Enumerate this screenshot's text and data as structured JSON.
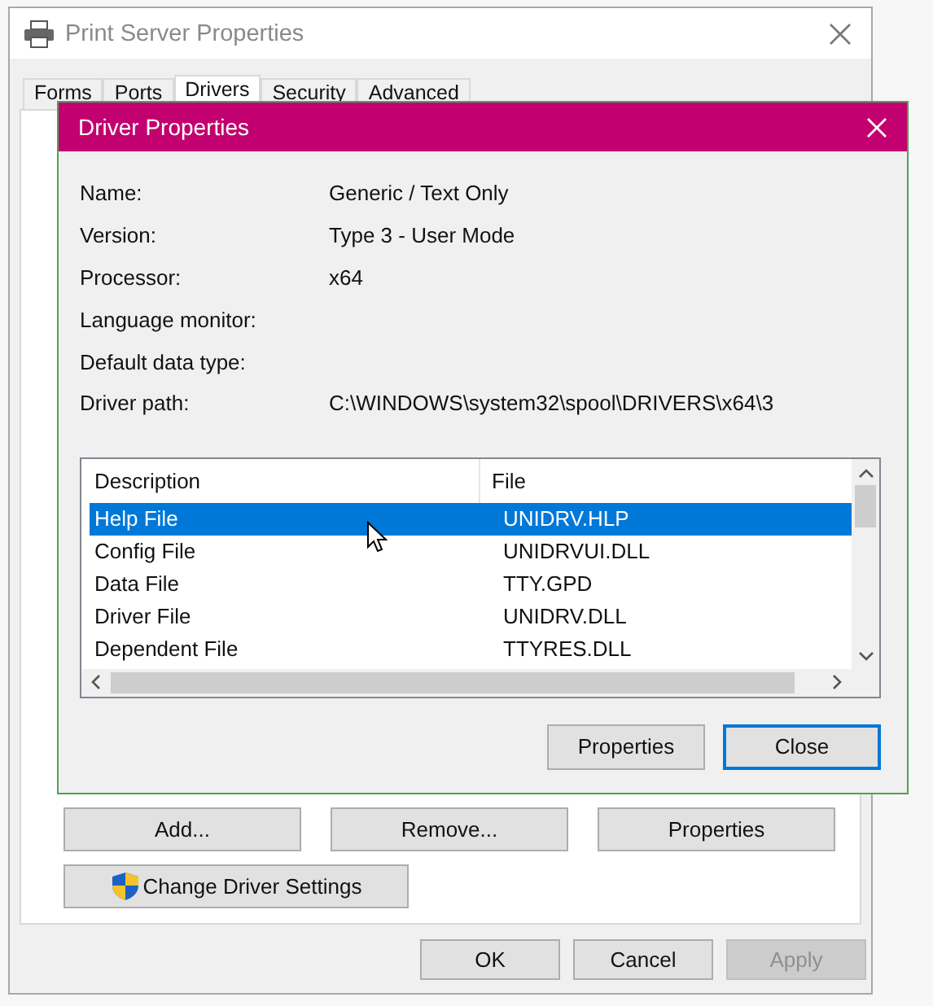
{
  "window": {
    "title": "Print Server Properties"
  },
  "tabs": [
    {
      "label": "Forms",
      "selected": false
    },
    {
      "label": "Ports",
      "selected": false
    },
    {
      "label": "Drivers",
      "selected": true
    },
    {
      "label": "Security",
      "selected": false
    },
    {
      "label": "Advanced",
      "selected": false
    }
  ],
  "dialog": {
    "title": "Driver Properties",
    "fields": [
      {
        "label": "Name:",
        "value": "Generic / Text Only"
      },
      {
        "label": "Version:",
        "value": "Type 3 - User Mode"
      },
      {
        "label": "Processor:",
        "value": "x64"
      },
      {
        "label": "Language monitor:"
      },
      {
        "label": "Default data type:"
      },
      {
        "label": "Driver path:",
        "value": "C:\\WINDOWS\\system32\\spool\\DRIVERS\\x64\\3"
      }
    ],
    "file_list": {
      "columns": [
        "Description",
        "File"
      ],
      "rows": [
        {
          "description": "Help File",
          "file": "UNIDRV.HLP",
          "selected": true
        },
        {
          "description": "Config File",
          "file": "UNIDRVUI.DLL",
          "selected": false
        },
        {
          "description": "Data File",
          "file": "TTY.GPD",
          "selected": false
        },
        {
          "description": "Driver File",
          "file": "UNIDRV.DLL",
          "selected": false
        },
        {
          "description": "Dependent File",
          "file": "TTYRES.DLL",
          "selected": false
        }
      ]
    },
    "buttons": [
      {
        "label": "Properties",
        "default": false
      },
      {
        "label": "Close",
        "default": true
      }
    ]
  },
  "driver_buttons": [
    "Add...",
    "Remove...",
    "Properties"
  ],
  "change_settings_button": "Change Driver Settings",
  "footer_buttons": [
    {
      "label": "OK",
      "disabled": false
    },
    {
      "label": "Cancel",
      "disabled": false
    },
    {
      "label": "Apply",
      "disabled": true
    }
  ]
}
